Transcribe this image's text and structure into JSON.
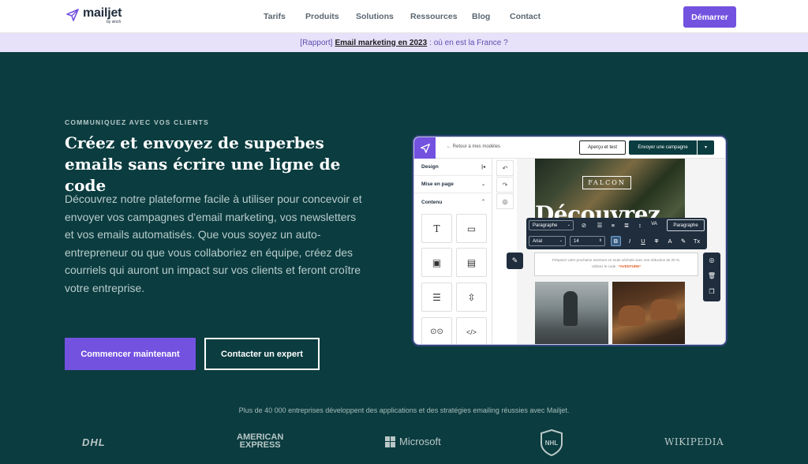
{
  "brand": {
    "name": "mailjet",
    "sub": "by sinch",
    "accent": "#7352e0",
    "hero_bg": "#0b3c3f"
  },
  "nav": {
    "links": [
      "Tarifs",
      "Produits",
      "Solutions",
      "Ressources",
      "Blog",
      "Contact"
    ],
    "cta": "Démarrer"
  },
  "banner": {
    "prefix": "[Rapport]",
    "link": "Email marketing en 2023",
    "suffix": ": où en est la France ?"
  },
  "hero": {
    "eyebrow": "COMMUNIQUEZ AVEC VOS CLIENTS",
    "headline": "Créez et envoyez de superbes emails sans écrire une ligne de code",
    "paragraph": "Découvrez notre plateforme facile à utiliser pour concevoir et envoyer vos campagnes d'email marketing, vos newsletters et vos emails automatisés. Que vous soyez un auto-entrepreneur ou que vous collaboriez en équipe, créez des courriels qui auront un impact sur vos clients et feront croître votre entreprise.",
    "primary_cta": "Commencer maintenant",
    "secondary_cta": "Contacter un expert"
  },
  "editor": {
    "back": "← Retour à mes modèles",
    "preview": "Aperçu et test",
    "send": "Envoyer une campagne",
    "sections": [
      "Design",
      "Mise en page",
      "Contenu"
    ],
    "falcon": "FALCON",
    "hero_word": "Découvrez",
    "toolbar": {
      "style": "Paragraphe",
      "font": "Arial",
      "size": "14",
      "paragraph_btn": "Paragraphe"
    },
    "textbox_line1": "Préparez votre prochaine aventure en toute sérénité avec une réduction de 20 %.",
    "textbox_line2_prefix": "Utilisez le code :",
    "textbox_code": "*AVENTURE*"
  },
  "trust": {
    "text": "Plus de 40 000 entreprises développent des applications et des stratégies emailing réussies avec Mailjet.",
    "logos": {
      "dhl": "DHL",
      "amex_1": "AMERICAN",
      "amex_2": "EXPRESS",
      "microsoft": "Microsoft",
      "nhl": "NHL",
      "wikipedia": "WIKIPEDIA"
    }
  }
}
